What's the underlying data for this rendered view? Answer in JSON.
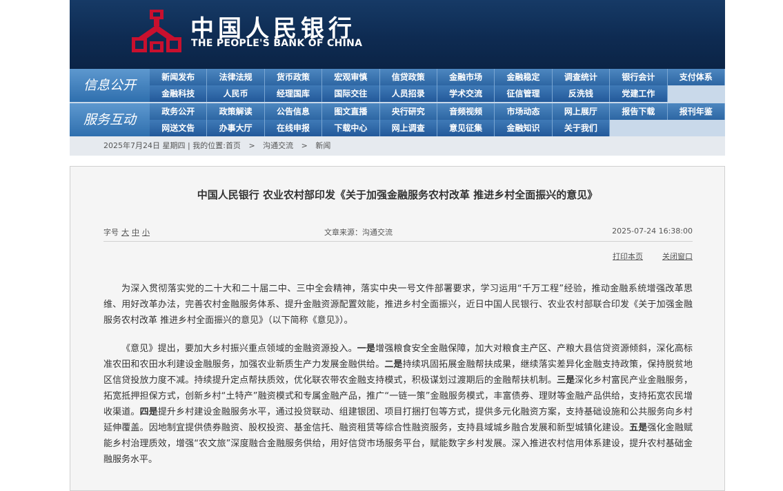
{
  "header": {
    "brand_cn": "中国人民银行",
    "brand_en": "THE PEOPLE'S BANK OF CHINA",
    "logo_icon": "pboc-logo-icon",
    "colors": {
      "banner": "#0e2b52",
      "nav": "#2d66a3",
      "accent_logo": "#c8102e"
    }
  },
  "nav": {
    "group1": {
      "label": "信息公开",
      "row1": [
        "新闻发布",
        "法律法规",
        "货币政策",
        "宏观审慎",
        "信贷政策",
        "金融市场",
        "金融稳定",
        "调查统计",
        "银行会计",
        "支付体系"
      ],
      "row2": [
        "金融科技",
        "人民币",
        "经理国库",
        "国际交往",
        "人员招录",
        "学术交流",
        "征信管理",
        "反洗钱",
        "党建工作"
      ]
    },
    "group2": {
      "label": "服务互动",
      "row1": [
        "政务公开",
        "政策解读",
        "公告信息",
        "图文直播",
        "央行研究",
        "音频视频",
        "市场动态",
        "网上展厅",
        "报告下载",
        "报刊年鉴"
      ],
      "row2": [
        "网送文告",
        "办事大厅",
        "在线申报",
        "下载中心",
        "网上调查",
        "意见征集",
        "金融知识",
        "关于我们"
      ]
    }
  },
  "breadcrumb": {
    "date": "2025年7月24日",
    "weekday": "星期四",
    "sep": "|",
    "location_label": "我的位置:",
    "items": [
      "首页",
      "沟通交流",
      "新闻"
    ],
    "arrow": ">"
  },
  "article": {
    "title": "中国人民银行 农业农村部印发《关于加强金融服务农村改革 推进乡村全面振兴的意见》",
    "font_size_label": "字号",
    "font_sizes": [
      "大",
      "中",
      "小"
    ],
    "source": "文章来源：沟通交流",
    "datetime": "2025-07-24 16:38:00",
    "print_label": "打印本页",
    "close_label": "关闭窗口",
    "para1": "为深入贯彻落实党的二十大和二十届二中、三中全会精神，落实中央一号文件部署要求，学习运用“千万工程”经验，推动金融系统增强改革思维、用好改革办法，完善农村金融服务体系、提升金融资源配置效能，推进乡村全面振兴，近日中国人民银行、农业农村部联合印发《关于加强金融服务农村改革 推进乡村全面振兴的意见》（以下简称《意见》）。",
    "para2": [
      {
        "t": "《意见》提出，要加大乡村振兴重点领域的金融资源投入。",
        "b": false
      },
      {
        "t": "一是",
        "b": true
      },
      {
        "t": "增强粮食安全金融保障，加大对粮食主产区、产粮大县信贷资源倾斜，深化高标准农田和农田水利建设金融服务，加强农业新质生产力发展金融供给。",
        "b": false
      },
      {
        "t": "二是",
        "b": true
      },
      {
        "t": "持续巩固拓展金融帮扶成果，继续落实差异化金融支持政策，保持脱贫地区信贷投放力度不减。持续提升定点帮扶质效，优化联农带农金融支持模式，积极谋划过渡期后的金融帮扶机制。",
        "b": false
      },
      {
        "t": "三是",
        "b": true
      },
      {
        "t": "深化乡村富民产业金融服务，拓宽抵押担保方式，创新乡村“土特产”融资模式和专属金融产品，推广“一链一策”金融服务模式，丰富债券、理财等金融产品供给，支持拓宽农民增收渠道。",
        "b": false
      },
      {
        "t": "四是",
        "b": true
      },
      {
        "t": "提升乡村建设金融服务水平，通过投贷联动、组建银团、项目打捆打包等方式，提供多元化融资方案，支持基础设施和公共服务向乡村延伸覆盖。因地制宜提供债券融资、股权投资、基金信托、融资租赁等综合性融资服务，支持县域城乡融合发展和新型城镇化建设。",
        "b": false
      },
      {
        "t": "五是",
        "b": true
      },
      {
        "t": "强化金融赋能乡村治理质效，增强“农文旅”深度融合金融服务供给，用好信贷市场服务平台，赋能数字乡村发展。深入推进农村信用体系建设，提升农村基础金融服务水平。",
        "b": false
      }
    ]
  }
}
